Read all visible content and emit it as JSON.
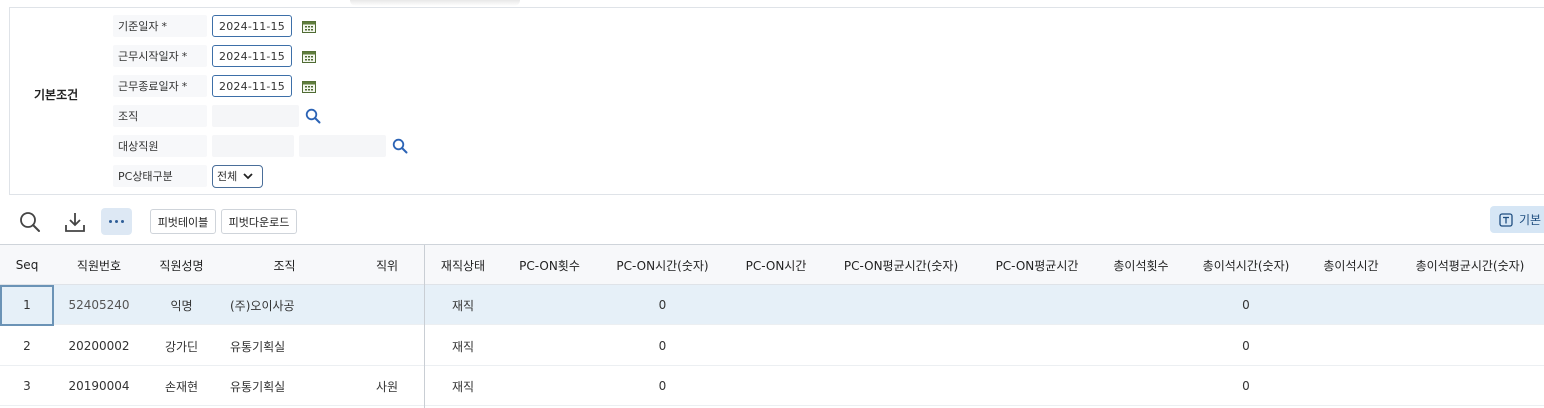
{
  "conditions": {
    "section_title": "기본조건",
    "fields": [
      {
        "label": "기준일자",
        "required": "*",
        "value": "2024-11-15"
      },
      {
        "label": "근무시작일자",
        "required": "*",
        "value": "2024-11-15"
      },
      {
        "label": "근무종료일자",
        "required": "*",
        "value": "2024-11-15"
      },
      {
        "label": "조직"
      },
      {
        "label": "대상직원"
      },
      {
        "label": "PC상태구분",
        "value": "전체"
      }
    ]
  },
  "toolbar": {
    "pivot_table": "피벗테이블",
    "pivot_download": "피벗다운로드",
    "basic": "기본"
  },
  "grid": {
    "columns": [
      "Seq",
      "직원번호",
      "직원성명",
      "조직",
      "직위",
      "재직상태",
      "PC-ON횟수",
      "PC-ON시간(숫자)",
      "PC-ON시간",
      "PC-ON평균시간(숫자)",
      "PC-ON평균시간",
      "총이석횟수",
      "총이석시간(숫자)",
      "총이석시간",
      "총이석평균시간(숫자)"
    ],
    "rows": [
      [
        "1",
        "52405240",
        "익명",
        "(주)오이사공",
        "",
        "재직",
        "",
        "0",
        "",
        "",
        "",
        "",
        "0",
        "",
        ""
      ],
      [
        "2",
        "20200002",
        "강가딘",
        "유통기획실",
        "",
        "재직",
        "",
        "0",
        "",
        "",
        "",
        "",
        "0",
        "",
        ""
      ],
      [
        "3",
        "20190004",
        "손재현",
        "유통기획실",
        "사원",
        "재직",
        "",
        "0",
        "",
        "",
        "",
        "",
        "0",
        "",
        ""
      ]
    ]
  }
}
